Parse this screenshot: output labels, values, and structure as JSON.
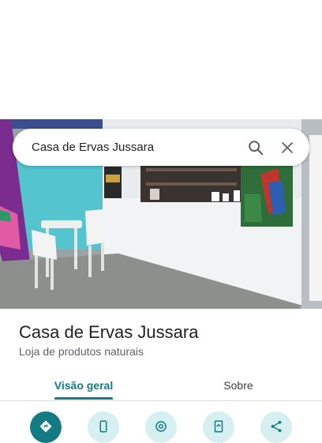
{
  "search": {
    "query": "Casa de Ervas Jussara"
  },
  "place": {
    "name": "Casa de Ervas Jussara",
    "category": "Loja de produtos naturais"
  },
  "tabs": [
    {
      "label": "Visão geral",
      "selected": true
    },
    {
      "label": "Sobre",
      "selected": false
    }
  ],
  "actions": [
    {
      "icon": "directions-icon"
    },
    {
      "icon": "phone-icon"
    },
    {
      "icon": "website-icon"
    },
    {
      "icon": "save-icon"
    },
    {
      "icon": "share-icon"
    }
  ],
  "colors": {
    "accent": "#137b83",
    "action_bg": "#d6eff1"
  }
}
